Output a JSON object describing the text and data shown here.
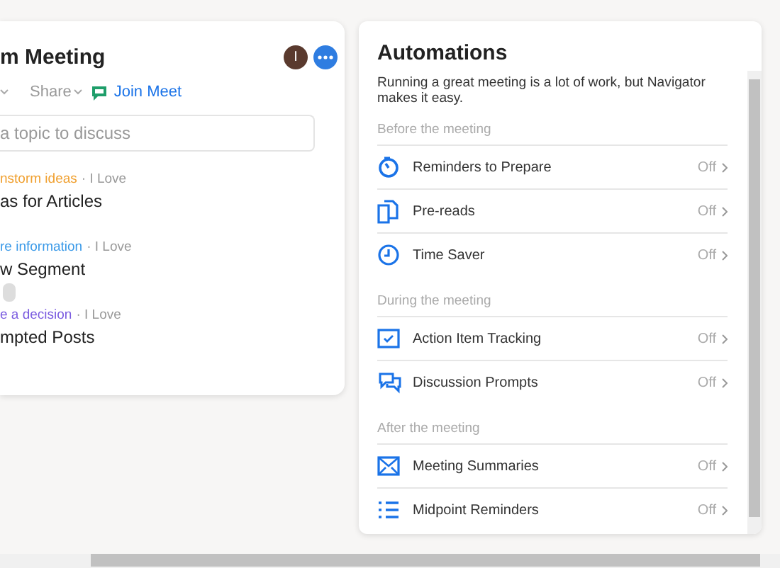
{
  "meeting_panel": {
    "title": "m Meeting",
    "avatar_initial": "I",
    "share_label": "Share",
    "join_label": "Join Meet",
    "topic_field": {
      "placeholder": "a topic to discuss"
    },
    "topics": [
      {
        "category": "nstorm ideas",
        "color": "#f0a030",
        "author": "· I Love",
        "title": "as for Articles"
      },
      {
        "category": "re information",
        "color": "#3b9ae8",
        "author": "· I Love",
        "title": "w Segment"
      },
      {
        "category": "e a decision",
        "color": "#7b5ce0",
        "author": "· I Love",
        "title": "mpted Posts"
      }
    ]
  },
  "automations": {
    "title": "Automations",
    "description": "Running a great meeting is a lot of work, but Navigator makes it easy.",
    "sections": [
      {
        "heading": "Before the meeting",
        "items": [
          {
            "kind": "timer",
            "label": "Reminders to Prepare",
            "status": "Off"
          },
          {
            "kind": "documents",
            "label": "Pre-reads",
            "status": "Off"
          },
          {
            "kind": "clock",
            "label": "Time Saver",
            "status": "Off"
          }
        ]
      },
      {
        "heading": "During the meeting",
        "items": [
          {
            "kind": "checkbox",
            "label": "Action Item Tracking",
            "status": "Off"
          },
          {
            "kind": "chat",
            "label": "Discussion Prompts",
            "status": "Off"
          }
        ]
      },
      {
        "heading": "After the meeting",
        "items": [
          {
            "kind": "envelope",
            "label": "Meeting Summaries",
            "status": "Off"
          },
          {
            "kind": "list",
            "label": "Midpoint Reminders",
            "status": "Off"
          }
        ]
      }
    ]
  }
}
